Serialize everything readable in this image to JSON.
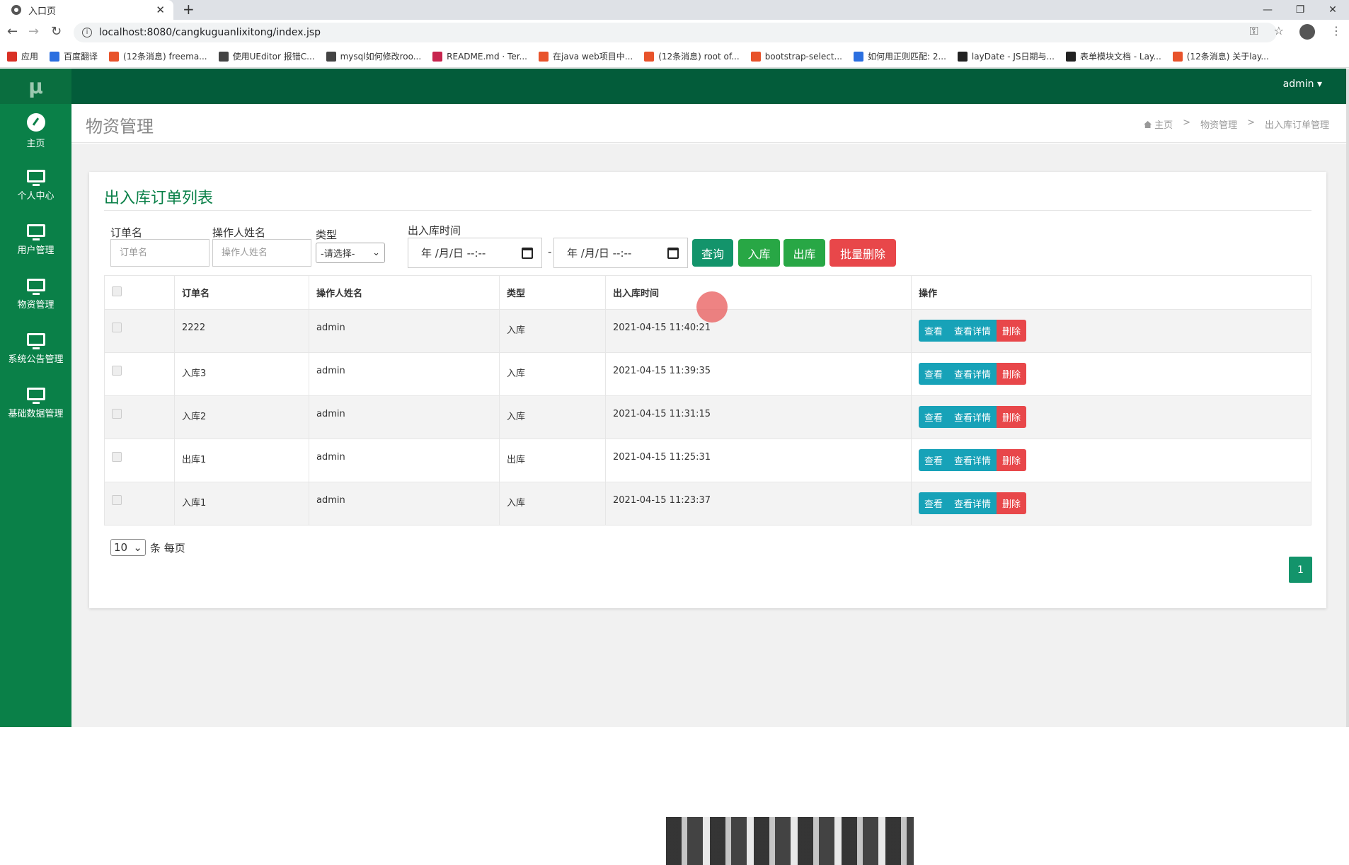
{
  "browser": {
    "tab_title": "入口页",
    "new_tab": "+",
    "url": "localhost:8080/cangkuguanlixitong/index.jsp",
    "bookmarks": [
      {
        "label": "应用",
        "color": "#d93025"
      },
      {
        "label": "百度翻译",
        "color": "#2b6fe0"
      },
      {
        "label": "(12条消息) freema...",
        "color": "#e8532b"
      },
      {
        "label": "使用UEditor 报错C...",
        "color": "#444444"
      },
      {
        "label": "mysql如何修改roo...",
        "color": "#444444"
      },
      {
        "label": "README.md · Ter...",
        "color": "#c7254e"
      },
      {
        "label": "在java web项目中...",
        "color": "#e8532b"
      },
      {
        "label": "(12条消息) root of...",
        "color": "#e8532b"
      },
      {
        "label": "bootstrap-select...",
        "color": "#e8532b"
      },
      {
        "label": "如何用正则匹配: 2...",
        "color": "#2b6fe0"
      },
      {
        "label": "layDate - JS日期与...",
        "color": "#222222"
      },
      {
        "label": "表单模块文档 - Lay...",
        "color": "#222222"
      },
      {
        "label": "(12条消息) 关于lay...",
        "color": "#e8532b"
      }
    ]
  },
  "app": {
    "logo": "μ",
    "user": "admin ▾",
    "sidebar": [
      {
        "label": "主页",
        "icon": "dashboard-icon"
      },
      {
        "label": "个人中心",
        "icon": "monitor-icon"
      },
      {
        "label": "用户管理",
        "icon": "monitor-icon"
      },
      {
        "label": "物资管理",
        "icon": "monitor-icon"
      },
      {
        "label": "系统公告管理",
        "icon": "monitor-icon"
      },
      {
        "label": "基础数据管理",
        "icon": "monitor-icon"
      }
    ],
    "page_title": "物资管理",
    "breadcrumb": [
      "主页",
      "物资管理",
      "出入库订单管理"
    ],
    "breadcrumb_sep": ">"
  },
  "panel": {
    "title": "出入库订单列表",
    "filters": {
      "order_label": "订单名",
      "order_placeholder": "订单名",
      "operator_label": "操作人姓名",
      "operator_placeholder": "操作人姓名",
      "type_label": "类型",
      "type_value": "-请选择-",
      "time_label": "出入库时间",
      "date_placeholder": "年 /月/日 --:--",
      "range_sep": "-"
    },
    "buttons": {
      "query": "查询",
      "in": "入库",
      "out": "出库",
      "batch_delete": "批量删除"
    },
    "table": {
      "headers": [
        "订单名",
        "操作人姓名",
        "类型",
        "出入库时间",
        "操作"
      ],
      "rows": [
        {
          "name": "2222",
          "operator": "admin",
          "type": "入库",
          "time": "2021-04-15 11:40:21"
        },
        {
          "name": "入库3",
          "operator": "admin",
          "type": "入库",
          "time": "2021-04-15 11:39:35"
        },
        {
          "name": "入库2",
          "operator": "admin",
          "type": "入库",
          "time": "2021-04-15 11:31:15"
        },
        {
          "name": "出库1",
          "operator": "admin",
          "type": "出库",
          "time": "2021-04-15 11:25:31"
        },
        {
          "name": "入库1",
          "operator": "admin",
          "type": "入库",
          "time": "2021-04-15 11:23:37"
        }
      ],
      "actions": {
        "view": "查看",
        "detail": "查看详情",
        "delete": "删除"
      }
    },
    "pagination": {
      "page_size": "10",
      "page_size_suffix": "条 每页",
      "current_page": "1"
    }
  },
  "colors": {
    "sidebar": "#0a8048",
    "topbar": "#035c3a",
    "accent": "#13946b",
    "danger": "#e8474a",
    "info": "#17a2b8"
  }
}
